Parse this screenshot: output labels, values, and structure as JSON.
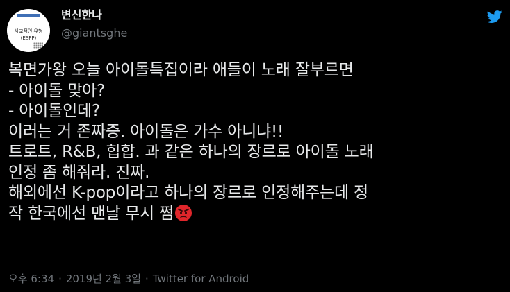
{
  "header": {
    "display_name": "변신한나",
    "handle": "@giantsghe",
    "avatar": {
      "line1": "사교적인 유형",
      "line2": "(ESFP)"
    },
    "brand_icon": "twitter-bird-icon"
  },
  "tweet": {
    "lines": [
      "복면가왕 오늘 아이돌특집이라 애들이 노래 잘부르면",
      "- 아이돌 맞아?",
      "- 아이돌인데?",
      "이러는 거 존짜증. 아이돌은 가수 아니냐!!",
      "트로트, R&B, 힙합. 과 같은 하나의 장르로 아이돌 노래",
      "인정 좀 해줘라. 진짜.",
      "해외에선 K-pop이라고 하나의 장르로 인정해주는데 정",
      "작 한국에선 맨날 무시 쩜"
    ],
    "emoji": "angry-face-emoji"
  },
  "meta": {
    "time": "오후 6:34",
    "separator": "·",
    "date": "2019년 2월 3일",
    "source": "Twitter for Android"
  },
  "colors": {
    "background": "#000000",
    "text": "#e7e9ea",
    "secondary": "#71767b",
    "twitter_blue": "#1d9bf0"
  }
}
